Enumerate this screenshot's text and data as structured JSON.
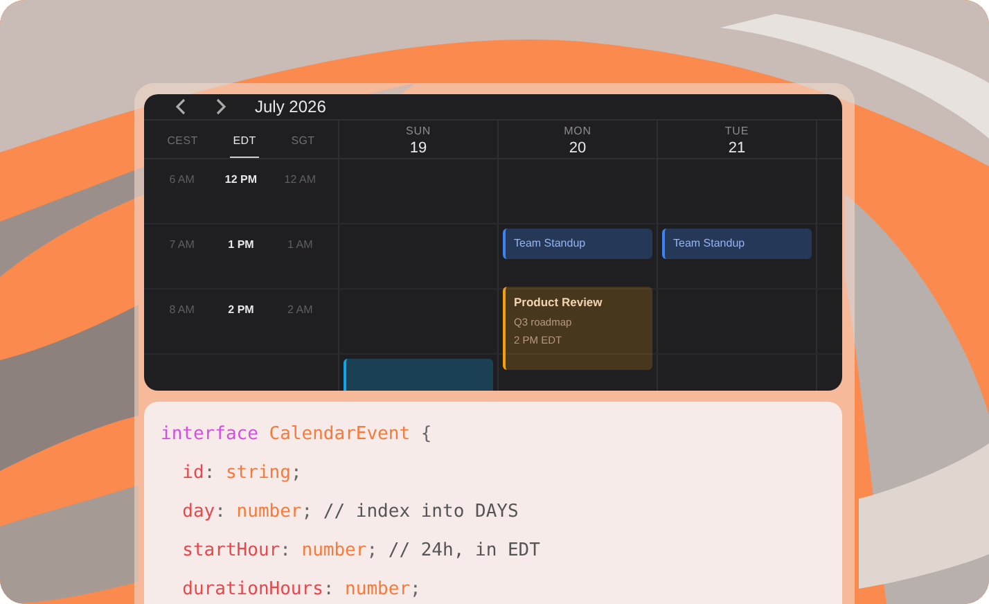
{
  "calendar": {
    "month": "July 2026",
    "timezones": [
      {
        "label": "CEST",
        "selected": false
      },
      {
        "label": "EDT",
        "selected": true
      },
      {
        "label": "SGT",
        "selected": false
      }
    ],
    "days": [
      {
        "weekday": "SUN",
        "date": "19"
      },
      {
        "weekday": "MON",
        "date": "20"
      },
      {
        "weekday": "TUE",
        "date": "21"
      }
    ],
    "rows": [
      {
        "times": [
          "6 AM",
          "12 PM",
          "12 AM"
        ],
        "cells": [
          {
            "kind": "empty"
          },
          {
            "kind": "empty"
          },
          {
            "kind": "empty"
          }
        ]
      },
      {
        "times": [
          "7 AM",
          "1 PM",
          "1 AM"
        ],
        "cells": [
          {
            "kind": "empty"
          },
          {
            "kind": "short",
            "title": "Team Standup",
            "color": "#3b82f6"
          },
          {
            "kind": "short",
            "title": "Team Standup",
            "color": "#3b82f6"
          }
        ]
      },
      {
        "times": [
          "8 AM",
          "2 PM",
          "2 AM"
        ],
        "cells": [
          {
            "kind": "empty"
          },
          {
            "kind": "long",
            "title": "Product Review",
            "subtitle": "Q3 roadmap",
            "time": "2 PM EDT",
            "color": "#f59e0b"
          },
          {
            "kind": "empty"
          }
        ]
      },
      {
        "cells": [
          {
            "kind": "cut",
            "color": "#0ea5e9"
          },
          {
            "kind": "empty"
          },
          {
            "kind": "empty"
          }
        ]
      }
    ]
  },
  "code": [
    [
      {
        "kind": "keyword",
        "text": "interface"
      },
      {
        "kind": "type",
        "text": " CalendarEvent"
      },
      {
        "kind": "punct",
        "text": " {"
      }
    ],
    [
      {
        "kind": "prop",
        "text": "  id"
      },
      {
        "kind": "punct",
        "text": ":"
      },
      {
        "kind": "type",
        "text": " string"
      },
      {
        "kind": "punct",
        "text": ";"
      }
    ],
    [
      {
        "kind": "prop",
        "text": "  day"
      },
      {
        "kind": "punct",
        "text": ":"
      },
      {
        "kind": "type",
        "text": " number"
      },
      {
        "kind": "punct",
        "text": ";"
      },
      {
        "kind": "comment",
        "text": " // index into DAYS"
      }
    ],
    [
      {
        "kind": "prop",
        "text": "  startHour"
      },
      {
        "kind": "punct",
        "text": ":"
      },
      {
        "kind": "type",
        "text": " number"
      },
      {
        "kind": "punct",
        "text": ";"
      },
      {
        "kind": "comment",
        "text": " // 24h, in EDT"
      }
    ],
    [
      {
        "kind": "prop",
        "text": "  durationHours"
      },
      {
        "kind": "punct",
        "text": ":"
      },
      {
        "kind": "type",
        "text": " number"
      },
      {
        "kind": "punct",
        "text": ";"
      }
    ]
  ]
}
